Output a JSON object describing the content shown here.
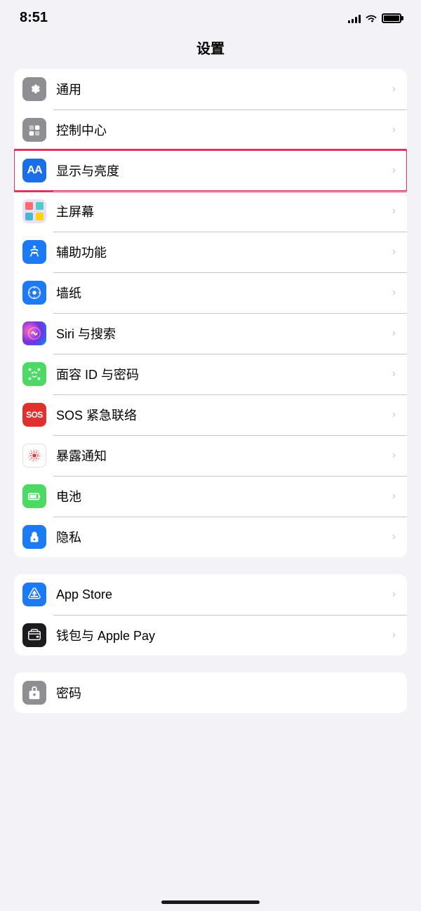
{
  "statusBar": {
    "time": "8:51"
  },
  "pageTitle": "设置",
  "section1": {
    "items": [
      {
        "id": "general",
        "label": "通用",
        "iconColor": "#8e8e93",
        "iconType": "gear",
        "highlighted": false
      },
      {
        "id": "control-center",
        "label": "控制中心",
        "iconColor": "#8e8e93",
        "iconType": "toggle",
        "highlighted": false
      },
      {
        "id": "display",
        "label": "显示与亮度",
        "iconColor": "#1a6fe8",
        "iconType": "display",
        "highlighted": true
      },
      {
        "id": "home-screen",
        "label": "主屏幕",
        "iconColor": "colorful",
        "iconType": "home",
        "highlighted": false
      },
      {
        "id": "accessibility",
        "label": "辅助功能",
        "iconColor": "#1c7af5",
        "iconType": "accessibility",
        "highlighted": false
      },
      {
        "id": "wallpaper",
        "label": "墙纸",
        "iconColor": "#1c7af5",
        "iconType": "wallpaper",
        "highlighted": false
      },
      {
        "id": "siri",
        "label": "Siri 与搜索",
        "iconColor": "siri",
        "iconType": "siri",
        "highlighted": false
      },
      {
        "id": "faceid",
        "label": "面容 ID 与密码",
        "iconColor": "#4cd964",
        "iconType": "faceid",
        "highlighted": false
      },
      {
        "id": "sos",
        "label": "SOS 紧急联络",
        "iconColor": "#e03030",
        "iconType": "sos",
        "highlighted": false
      },
      {
        "id": "exposure",
        "label": "暴露通知",
        "iconColor": "exposure",
        "iconType": "exposure",
        "highlighted": false
      },
      {
        "id": "battery",
        "label": "电池",
        "iconColor": "#4cd964",
        "iconType": "battery",
        "highlighted": false
      },
      {
        "id": "privacy",
        "label": "隐私",
        "iconColor": "#1c7af5",
        "iconType": "privacy",
        "highlighted": false
      }
    ]
  },
  "section2": {
    "items": [
      {
        "id": "appstore",
        "label": "App Store",
        "iconColor": "#1c7af5",
        "iconType": "appstore",
        "highlighted": false
      },
      {
        "id": "wallet",
        "label": "钱包与 Apple Pay",
        "iconColor": "#1c1c1e",
        "iconType": "wallet",
        "highlighted": false
      }
    ]
  },
  "section3": {
    "items": [
      {
        "id": "password",
        "label": "密码",
        "iconColor": "#8e8e93",
        "iconType": "password",
        "highlighted": false
      }
    ]
  },
  "chevron": "›"
}
